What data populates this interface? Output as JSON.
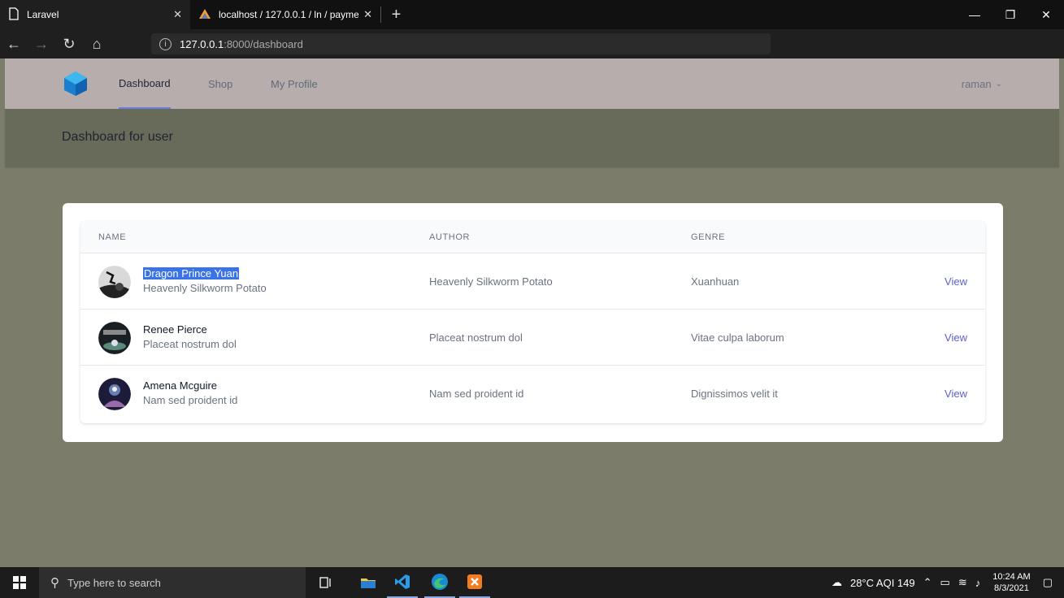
{
  "browser": {
    "tabs": [
      {
        "title": "Laravel",
        "active": true
      },
      {
        "title": "localhost / 127.0.0.1 / ln / payme",
        "active": false
      }
    ],
    "url_host": "127.0.0.1",
    "url_rest": ":8000/dashboard"
  },
  "nav": {
    "links": [
      "Dashboard",
      "Shop",
      "My Profile"
    ],
    "active": "Dashboard",
    "user": "raman"
  },
  "header": {
    "title": "Dashboard for user"
  },
  "table": {
    "columns": [
      "NAME",
      "AUTHOR",
      "GENRE"
    ],
    "rows": [
      {
        "name": "Dragon Prince Yuan",
        "subtitle": "Heavenly Silkworm Potato",
        "author": "Heavenly Silkworm Potato",
        "genre": "Xuanhuan",
        "action": "View"
      },
      {
        "name": "Renee Pierce",
        "subtitle": "Placeat nostrum dol",
        "author": "Placeat nostrum dol",
        "genre": "Vitae culpa laborum",
        "action": "View"
      },
      {
        "name": "Amena Mcguire",
        "subtitle": "Nam sed proident id",
        "author": "Nam sed proident id",
        "genre": "Dignissimos velit it",
        "action": "View"
      }
    ]
  },
  "taskbar": {
    "search_placeholder": "Type here to search",
    "weather": "28°C AQI 149",
    "time": "10:24 AM",
    "date": "8/3/2021"
  },
  "colors": {
    "page_bg": "#7b7c6a",
    "navbar_bg": "#b8adad",
    "header_bg": "#686a5a",
    "link_accent": "#5b5fd1",
    "selection": "#3a72e8"
  }
}
